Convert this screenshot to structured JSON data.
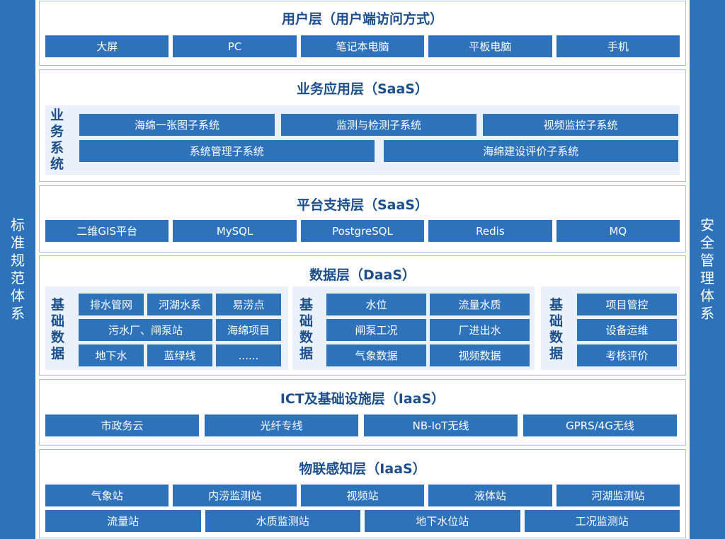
{
  "side_left": {
    "label": [
      "标",
      "准",
      "规",
      "范",
      "体",
      "系"
    ]
  },
  "side_right": {
    "label": [
      "安",
      "全",
      "管",
      "理",
      "体",
      "系"
    ]
  },
  "user_layer": {
    "title": "用户层（用户端访问方式）",
    "items": [
      "大屏",
      "PC",
      "笔记本电脑",
      "平板电脑",
      "手机"
    ]
  },
  "business_layer": {
    "title": "业务应用层（SaaS）",
    "label": [
      "业",
      "务",
      "系",
      "统"
    ],
    "row1": [
      "海绵一张图子系统",
      "监测与检测子系统",
      "视频监控子系统"
    ],
    "row2": [
      "系统管理子系统",
      "海绵建设评价子系统"
    ]
  },
  "platform_layer": {
    "title": "平台支持层（SaaS）",
    "items": [
      "二维GIS平台",
      "MySQL",
      "PostgreSQL",
      "Redis",
      "MQ"
    ]
  },
  "data_layer": {
    "title": "数据层（DaaS）",
    "group1": {
      "label": [
        "基",
        "础",
        "数",
        "据"
      ],
      "items": [
        "排水管网",
        "河湖水系",
        "易涝点",
        "污水厂、闸泵站",
        "海绵项目",
        "地下水",
        "蓝绿线",
        "......"
      ]
    },
    "group2": {
      "label": [
        "基",
        "础",
        "数",
        "据"
      ],
      "items": [
        "水位",
        "流量水质",
        "闸泵工况",
        "厂进出水",
        "气象数据",
        "视频数据"
      ]
    },
    "group3": {
      "label": [
        "基",
        "础",
        "数",
        "据"
      ],
      "items": [
        "项目管控",
        "设备运维",
        "考核评价"
      ]
    }
  },
  "ict_layer": {
    "title": "ICT及基础设施层（IaaS）",
    "items": [
      "市政务云",
      "光纤专线",
      "NB-IoT无线",
      "GPRS/4G无线"
    ]
  },
  "iot_layer": {
    "title": "物联感知层（IaaS）",
    "row1": [
      "气象站",
      "内涝监测站",
      "视频站",
      "液体站",
      "河湖监测站"
    ],
    "row2": [
      "流量站",
      "水质监测站",
      "地下水位站",
      "工况监测站"
    ]
  },
  "colors": {
    "box": "#2e73b9",
    "title": "#1d4f8a",
    "border": "#9ec3e6",
    "panel": "#eaf1fa"
  }
}
